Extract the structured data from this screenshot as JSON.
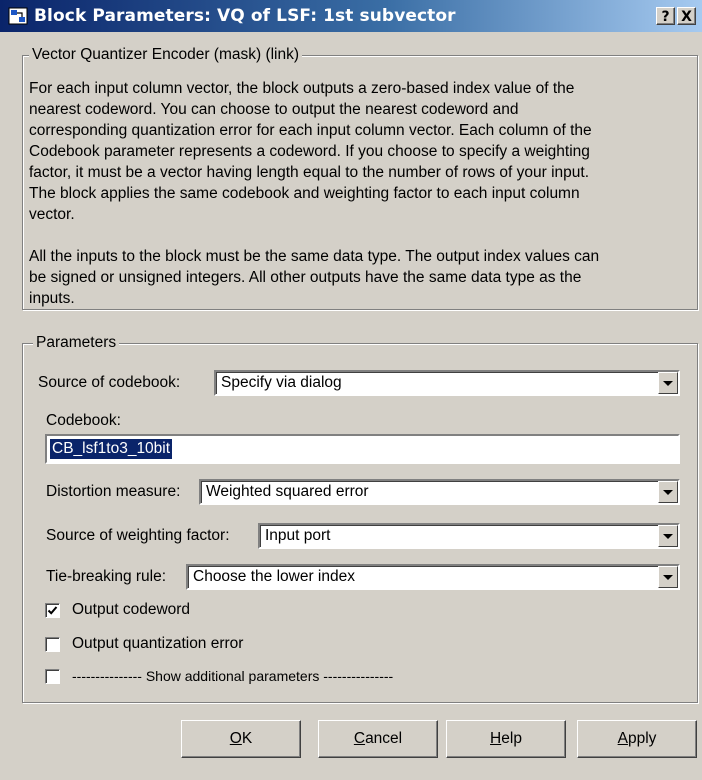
{
  "window": {
    "title": "Block Parameters: VQ of LSF: 1st subvector",
    "help_button": "?",
    "close_button": "X",
    "title_gradient_start": "#0a246a",
    "title_gradient_end": "#a6caf0"
  },
  "mask": {
    "legend": "Vector Quantizer Encoder (mask) (link)",
    "paragraph1_lines": [
      "For each input column vector, the block outputs a zero-based index value of the",
      "nearest codeword. You can choose to output the nearest codeword and",
      "corresponding quantization error for each input column vector. Each column of the",
      "Codebook parameter represents a codeword. If you choose to specify a weighting",
      "factor, it must be a vector having length equal to the number of rows of your input.",
      "The block applies the same codebook and weighting factor to each input column",
      "vector."
    ],
    "paragraph2_lines": [
      "All the inputs to the block must be the same data type. The output index values can",
      "be signed or unsigned integers. All other outputs have the same data type as the",
      "inputs."
    ]
  },
  "parameters": {
    "legend": "Parameters",
    "source_of_codebook": {
      "label": "Source of codebook:",
      "value": "Specify via dialog"
    },
    "codebook": {
      "label": "Codebook:",
      "value": "CB_lsf1to3_10bit"
    },
    "distortion_measure": {
      "label": "Distortion measure:",
      "value": "Weighted squared error"
    },
    "source_of_weighting": {
      "label": "Source of weighting factor:",
      "value": "Input port"
    },
    "tie_breaking": {
      "label": "Tie-breaking rule:",
      "value": "Choose the lower index"
    },
    "output_codeword": {
      "label": "Output codeword",
      "checked": true
    },
    "output_quant_error": {
      "label": "Output quantization error",
      "checked": false
    },
    "show_additional": {
      "label": "--------------- Show additional parameters ---------------",
      "checked": false
    }
  },
  "buttons": {
    "ok": {
      "accel": "O",
      "rest": "K"
    },
    "cancel": {
      "accel": "C",
      "rest": "ancel"
    },
    "help": {
      "accel": "H",
      "rest": "elp"
    },
    "apply": {
      "accel": "A",
      "rest": "pply"
    }
  },
  "icons": {
    "app": "simulink-block-icon",
    "dropdown": "chevron-down-icon",
    "check": "check-icon"
  }
}
